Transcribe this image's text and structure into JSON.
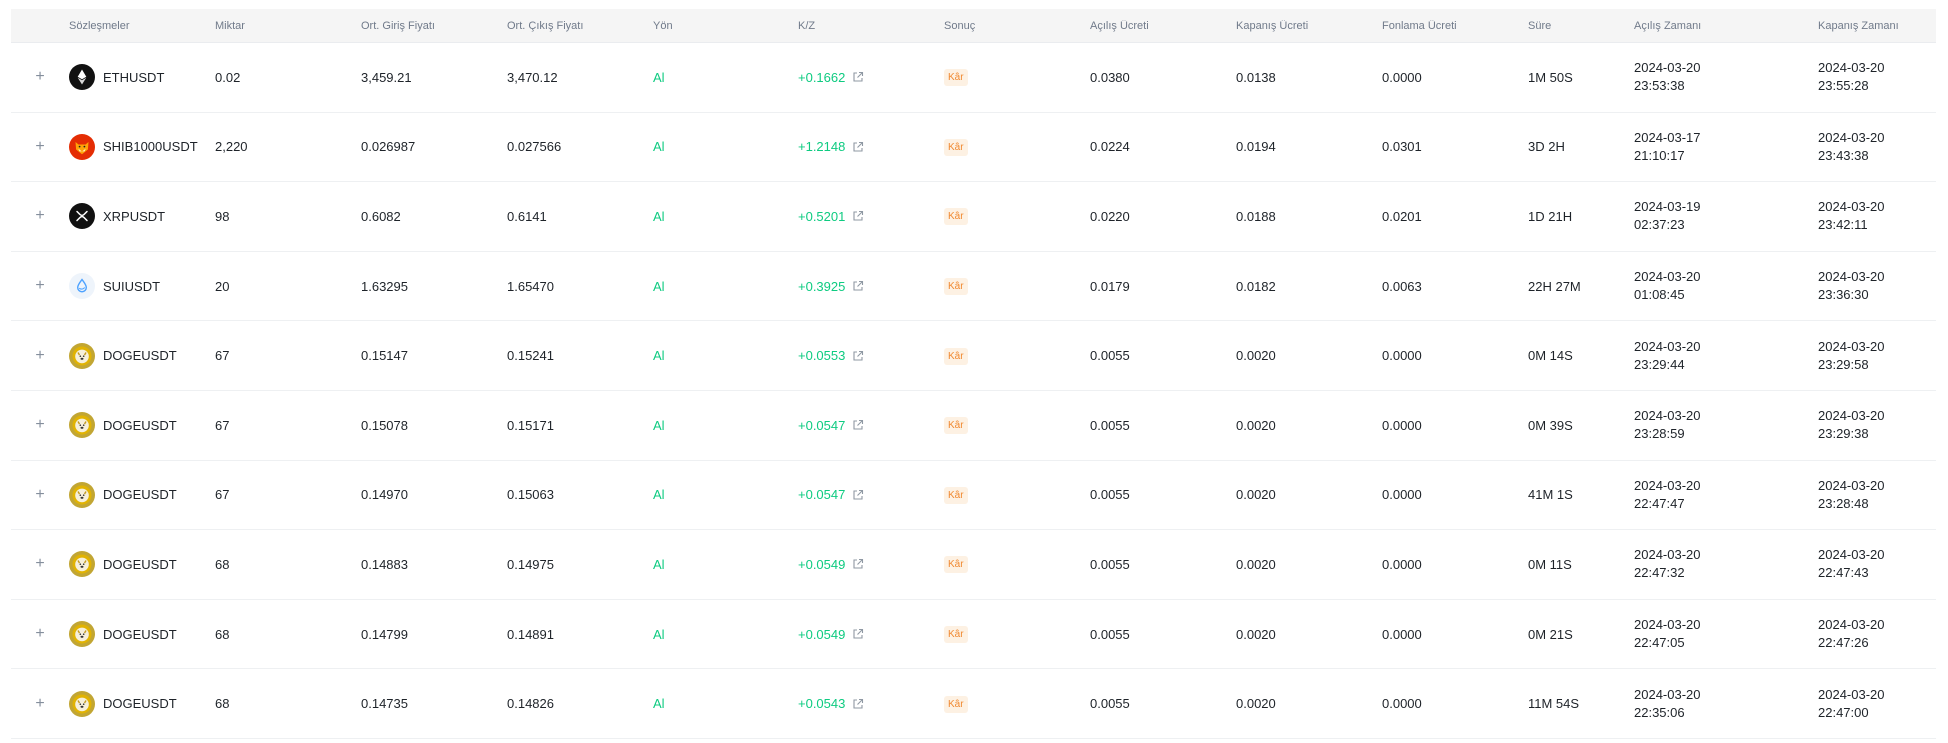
{
  "headers": {
    "symbol": "Sözleşmeler",
    "qty": "Miktar",
    "entry": "Ort. Giriş Fiyatı",
    "exit": "Ort. Çıkış Fiyatı",
    "side": "Yön",
    "pnl": "K/Z",
    "result": "Sonuç",
    "open_fee": "Açılış Ücreti",
    "close_fee": "Kapanış Ücreti",
    "funding_fee": "Fonlama Ücreti",
    "duration": "Süre",
    "open_time": "Açılış Zamanı",
    "close_time": "Kapanış Zamanı"
  },
  "expand_glyph": "+",
  "colors": {
    "positive": "#0ecb81",
    "badge_text": "#f0882f",
    "badge_bg": "#fdf1e3"
  },
  "rows": [
    {
      "icon": "eth-coin-icon",
      "symbol": "ETHUSDT",
      "qty": "0.02",
      "entry": "3,459.21",
      "exit": "3,470.12",
      "side": "Al",
      "pnl": "+0.1662",
      "result": "Kâr",
      "open_fee": "0.0380",
      "close_fee": "0.0138",
      "funding_fee": "0.0000",
      "duration": "1M 50S",
      "open_date": "2024-03-20",
      "open_clock": "23:53:38",
      "close_date": "2024-03-20",
      "close_clock": "23:55:28"
    },
    {
      "icon": "shib-coin-icon",
      "symbol": "SHIB1000USDT",
      "qty": "2,220",
      "entry": "0.026987",
      "exit": "0.027566",
      "side": "Al",
      "pnl": "+1.2148",
      "result": "Kâr",
      "open_fee": "0.0224",
      "close_fee": "0.0194",
      "funding_fee": "0.0301",
      "duration": "3D 2H",
      "open_date": "2024-03-17",
      "open_clock": "21:10:17",
      "close_date": "2024-03-20",
      "close_clock": "23:43:38"
    },
    {
      "icon": "xrp-coin-icon",
      "symbol": "XRPUSDT",
      "qty": "98",
      "entry": "0.6082",
      "exit": "0.6141",
      "side": "Al",
      "pnl": "+0.5201",
      "result": "Kâr",
      "open_fee": "0.0220",
      "close_fee": "0.0188",
      "funding_fee": "0.0201",
      "duration": "1D 21H",
      "open_date": "2024-03-19",
      "open_clock": "02:37:23",
      "close_date": "2024-03-20",
      "close_clock": "23:42:11"
    },
    {
      "icon": "sui-coin-icon",
      "symbol": "SUIUSDT",
      "qty": "20",
      "entry": "1.63295",
      "exit": "1.65470",
      "side": "Al",
      "pnl": "+0.3925",
      "result": "Kâr",
      "open_fee": "0.0179",
      "close_fee": "0.0182",
      "funding_fee": "0.0063",
      "duration": "22H 27M",
      "open_date": "2024-03-20",
      "open_clock": "01:08:45",
      "close_date": "2024-03-20",
      "close_clock": "23:36:30"
    },
    {
      "icon": "doge-coin-icon",
      "symbol": "DOGEUSDT",
      "qty": "67",
      "entry": "0.15147",
      "exit": "0.15241",
      "side": "Al",
      "pnl": "+0.0553",
      "result": "Kâr",
      "open_fee": "0.0055",
      "close_fee": "0.0020",
      "funding_fee": "0.0000",
      "duration": "0M 14S",
      "open_date": "2024-03-20",
      "open_clock": "23:29:44",
      "close_date": "2024-03-20",
      "close_clock": "23:29:58"
    },
    {
      "icon": "doge-coin-icon",
      "symbol": "DOGEUSDT",
      "qty": "67",
      "entry": "0.15078",
      "exit": "0.15171",
      "side": "Al",
      "pnl": "+0.0547",
      "result": "Kâr",
      "open_fee": "0.0055",
      "close_fee": "0.0020",
      "funding_fee": "0.0000",
      "duration": "0M 39S",
      "open_date": "2024-03-20",
      "open_clock": "23:28:59",
      "close_date": "2024-03-20",
      "close_clock": "23:29:38"
    },
    {
      "icon": "doge-coin-icon",
      "symbol": "DOGEUSDT",
      "qty": "67",
      "entry": "0.14970",
      "exit": "0.15063",
      "side": "Al",
      "pnl": "+0.0547",
      "result": "Kâr",
      "open_fee": "0.0055",
      "close_fee": "0.0020",
      "funding_fee": "0.0000",
      "duration": "41M 1S",
      "open_date": "2024-03-20",
      "open_clock": "22:47:47",
      "close_date": "2024-03-20",
      "close_clock": "23:28:48"
    },
    {
      "icon": "doge-coin-icon",
      "symbol": "DOGEUSDT",
      "qty": "68",
      "entry": "0.14883",
      "exit": "0.14975",
      "side": "Al",
      "pnl": "+0.0549",
      "result": "Kâr",
      "open_fee": "0.0055",
      "close_fee": "0.0020",
      "funding_fee": "0.0000",
      "duration": "0M 11S",
      "open_date": "2024-03-20",
      "open_clock": "22:47:32",
      "close_date": "2024-03-20",
      "close_clock": "22:47:43"
    },
    {
      "icon": "doge-coin-icon",
      "symbol": "DOGEUSDT",
      "qty": "68",
      "entry": "0.14799",
      "exit": "0.14891",
      "side": "Al",
      "pnl": "+0.0549",
      "result": "Kâr",
      "open_fee": "0.0055",
      "close_fee": "0.0020",
      "funding_fee": "0.0000",
      "duration": "0M 21S",
      "open_date": "2024-03-20",
      "open_clock": "22:47:05",
      "close_date": "2024-03-20",
      "close_clock": "22:47:26"
    },
    {
      "icon": "doge-coin-icon",
      "symbol": "DOGEUSDT",
      "qty": "68",
      "entry": "0.14735",
      "exit": "0.14826",
      "side": "Al",
      "pnl": "+0.0543",
      "result": "Kâr",
      "open_fee": "0.0055",
      "close_fee": "0.0020",
      "funding_fee": "0.0000",
      "duration": "11M 54S",
      "open_date": "2024-03-20",
      "open_clock": "22:35:06",
      "close_date": "2024-03-20",
      "close_clock": "22:47:00"
    }
  ]
}
